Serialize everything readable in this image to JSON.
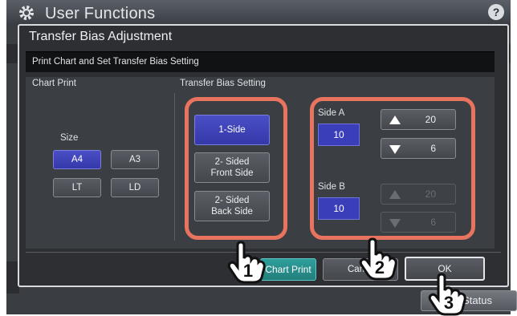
{
  "header": {
    "title": "User Functions",
    "help_label": "?"
  },
  "dialog": {
    "title": "Transfer Bias Adjustment",
    "subtitle": "Print Chart and Set Transfer Bias Setting",
    "chart_print": {
      "section_label": "Chart Print",
      "size_label": "Size",
      "sizes": [
        {
          "label": "A4",
          "selected": true
        },
        {
          "label": "A3",
          "selected": false
        },
        {
          "label": "LT",
          "selected": false
        },
        {
          "label": "LD",
          "selected": false
        }
      ]
    },
    "transfer_bias": {
      "section_label": "Transfer Bias Setting",
      "modes": [
        {
          "label": "1-Side",
          "selected": true
        },
        {
          "label": "2- Sided\nFront Side",
          "selected": false
        },
        {
          "label": "2- Sided\nBack Side",
          "selected": false
        }
      ],
      "side_a": {
        "label": "Side A",
        "value": "10",
        "up_value": "20",
        "down_value": "6"
      },
      "side_b": {
        "label": "Side B",
        "value": "10",
        "up_value": "20",
        "down_value": "6"
      }
    },
    "footer": {
      "chart_print_label": "Chart Print",
      "cancel_label": "Cancel",
      "ok_label": "OK"
    }
  },
  "status_button_label": "Job Status",
  "callouts": [
    "1",
    "2",
    "3"
  ],
  "colors": {
    "highlight": "#e8735f",
    "selected": "#3a3fb9",
    "teal": "#2a918e"
  }
}
